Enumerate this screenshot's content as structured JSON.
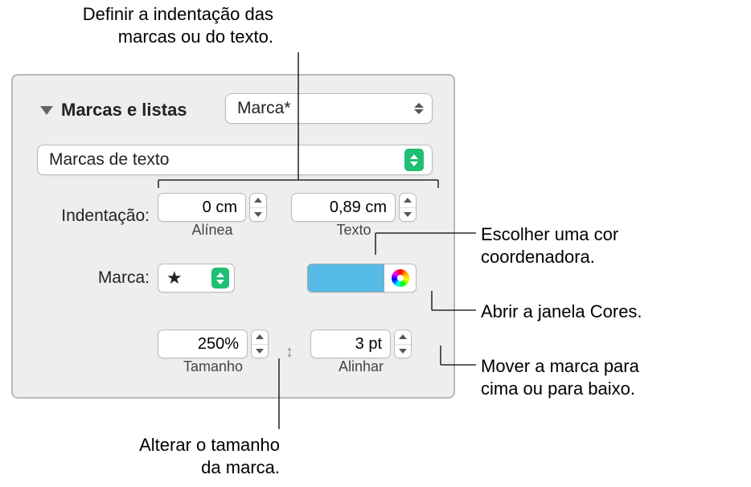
{
  "callouts": {
    "indent": "Definir a indentação das\nmarcas ou do texto.",
    "coordColor": "Escolher uma cor\ncoordenadora.",
    "openColors": "Abrir a janela Cores.",
    "moveBullet": "Mover a marca para\ncima ou para baixo.",
    "bulletSize": "Alterar o tamanho\nda marca."
  },
  "panel": {
    "title": "Marcas e listas",
    "stylePopup": "Marca*",
    "bulletTypePopup": "Marcas de texto",
    "indentLabel": "Indentação:",
    "bulletIndent": {
      "value": "0 cm",
      "sublabel": "Alínea"
    },
    "textIndent": {
      "value": "0,89 cm",
      "sublabel": "Texto"
    },
    "bulletLabel": "Marca:",
    "bulletGlyph": "★",
    "colorWell": "#56bbe6",
    "size": {
      "value": "250%",
      "sublabel": "Tamanho"
    },
    "align": {
      "value": "3 pt",
      "sublabel": "Alinhar"
    },
    "alignLockGlyph": "↕"
  }
}
